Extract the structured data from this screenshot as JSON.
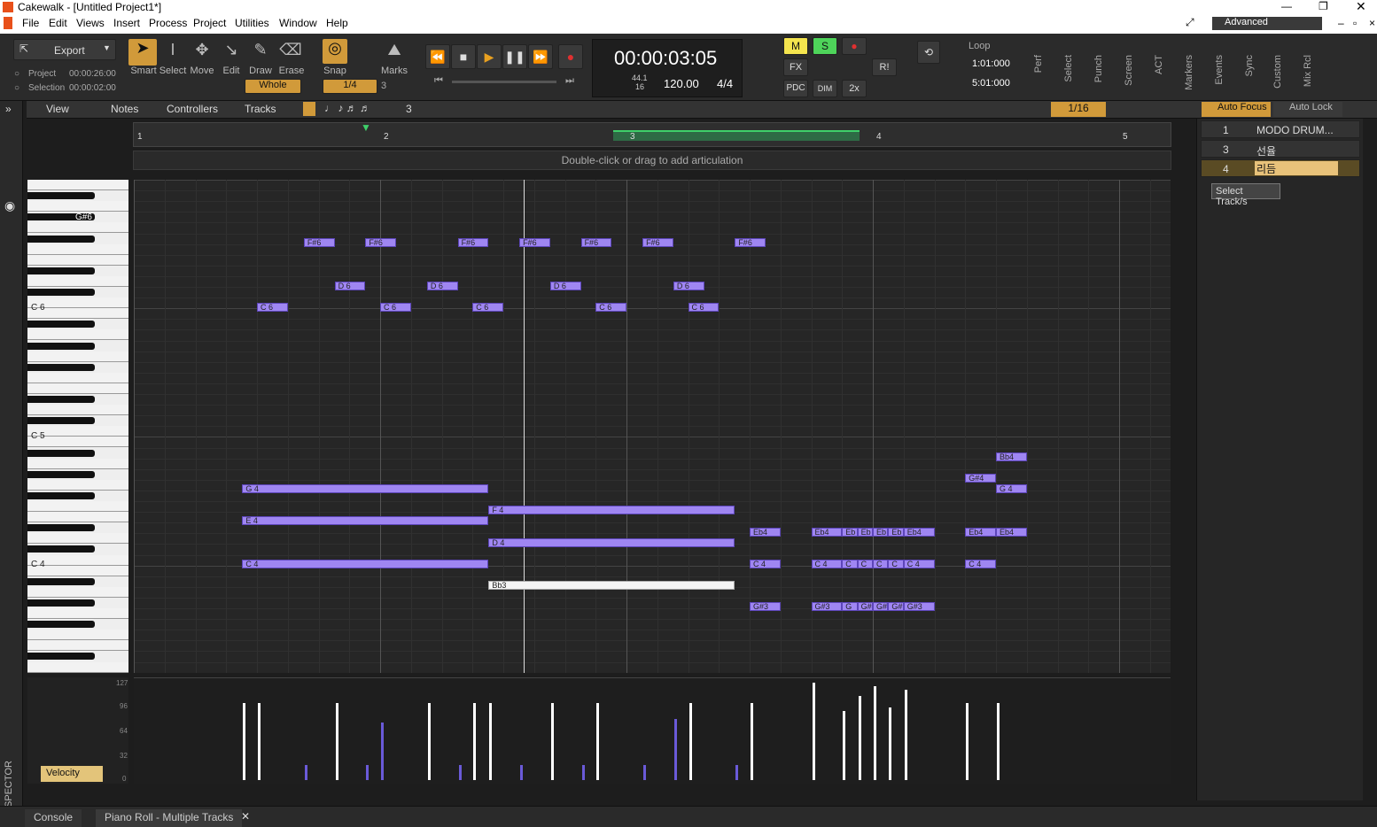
{
  "app": {
    "title": "Cakewalk - [Untitled Project1*]"
  },
  "menu": [
    "File",
    "Edit",
    "Views",
    "Insert",
    "Process",
    "Project",
    "Utilities",
    "Window",
    "Help"
  ],
  "workspace": {
    "label": "Advanced"
  },
  "export": {
    "label": "Export",
    "project_label": "Project",
    "project_time": "00:00:26:00",
    "selection_label": "Selection",
    "selection_time": "00:00:02:00"
  },
  "tools": [
    "Smart",
    "Select",
    "Move",
    "Edit",
    "Draw",
    "Erase"
  ],
  "snap": {
    "label": "Snap",
    "value": "Whole",
    "marks": "Marks",
    "fraction": "1/4",
    "tuplet": "3"
  },
  "transport": {
    "time": "00:00:03:05",
    "sample_rate": "44.1",
    "bits": "16",
    "tempo": "120.00",
    "meter": "4/4"
  },
  "mix": {
    "m": "M",
    "s": "S",
    "fx": "FX",
    "pdc": "PDC",
    "dim": "DIM",
    "x2": "2x",
    "r": "R!"
  },
  "loop": {
    "label": "Loop",
    "start": "1:01:000",
    "end": "5:01:000"
  },
  "modules": [
    "Perf",
    "Select",
    "Punch",
    "Screen",
    "ACT",
    "Markers",
    "Events",
    "Sync",
    "Custom",
    "Mix Rcl"
  ],
  "subbar": {
    "view": "View",
    "notes": "Notes",
    "controllers": "Controllers",
    "tracks": "Tracks",
    "tuplet": "3",
    "grid": "1/16",
    "auto_focus": "Auto Focus",
    "auto_lock": "Auto Lock"
  },
  "ruler": {
    "bars": [
      "1",
      "2",
      "3",
      "4",
      "5"
    ]
  },
  "articulation_hint": "Double-click or drag to add articulation",
  "keys": {
    "g6": "G#6",
    "c6": "C 6",
    "c5": "C 5",
    "c4": "C 4"
  },
  "notes": [
    {
      "label": "F#6",
      "row": "Fs6",
      "start": 2.38,
      "len": 0.25
    },
    {
      "label": "F#6",
      "row": "Fs6",
      "start": 2.88,
      "len": 0.25
    },
    {
      "label": "F#6",
      "row": "Fs6",
      "start": 3.63,
      "len": 0.25
    },
    {
      "label": "F#6",
      "row": "Fs6",
      "start": 4.13,
      "len": 0.25
    },
    {
      "label": "F#6",
      "row": "Fs6",
      "start": 4.63,
      "len": 0.25
    },
    {
      "label": "F#6",
      "row": "Fs6",
      "start": 5.13,
      "len": 0.25
    },
    {
      "label": "F#6",
      "row": "Fs6",
      "start": 5.88,
      "len": 0.25
    },
    {
      "label": "D 6",
      "row": "D6",
      "start": 2.63,
      "len": 0.25
    },
    {
      "label": "D 6",
      "row": "D6",
      "start": 3.38,
      "len": 0.25
    },
    {
      "label": "D 6",
      "row": "D6",
      "start": 4.38,
      "len": 0.25
    },
    {
      "label": "D 6",
      "row": "D6",
      "start": 5.38,
      "len": 0.25
    },
    {
      "label": "C 6",
      "row": "C6",
      "start": 2.0,
      "len": 0.25
    },
    {
      "label": "C 6",
      "row": "C6",
      "start": 3.0,
      "len": 0.25
    },
    {
      "label": "C 6",
      "row": "C6",
      "start": 3.75,
      "len": 0.25
    },
    {
      "label": "C 6",
      "row": "C6",
      "start": 4.75,
      "len": 0.25
    },
    {
      "label": "C 6",
      "row": "C6",
      "start": 5.5,
      "len": 0.25
    },
    {
      "label": "G 4",
      "row": "G4",
      "start": 1.88,
      "len": 2.0
    },
    {
      "label": "E 4",
      "row": "E4",
      "start": 1.88,
      "len": 2.0
    },
    {
      "label": "C 4",
      "row": "C4",
      "start": 1.88,
      "len": 2.0
    },
    {
      "label": "F 4",
      "row": "F4",
      "start": 3.88,
      "len": 2.0
    },
    {
      "label": "D 4",
      "row": "D4",
      "start": 3.88,
      "len": 2.0
    },
    {
      "label": "Bb3",
      "row": "Bb3",
      "start": 3.88,
      "len": 2.0,
      "selected": true
    },
    {
      "label": "Eb4",
      "row": "Eb4",
      "start": 6.0,
      "len": 0.25
    },
    {
      "label": "C 4",
      "row": "C4",
      "start": 6.0,
      "len": 0.25
    },
    {
      "label": "G#3",
      "row": "Gs3",
      "start": 6.0,
      "len": 0.25
    },
    {
      "label": "Eb4",
      "row": "Eb4",
      "start": 6.5,
      "len": 0.25
    },
    {
      "label": "C 4",
      "row": "C4",
      "start": 6.5,
      "len": 0.25
    },
    {
      "label": "G#3",
      "row": "Gs3",
      "start": 6.5,
      "len": 0.25
    },
    {
      "label": "Eb",
      "row": "Eb4",
      "start": 6.75,
      "len": 0.125
    },
    {
      "label": "C",
      "row": "C4",
      "start": 6.75,
      "len": 0.125
    },
    {
      "label": "G",
      "row": "Gs3",
      "start": 6.75,
      "len": 0.125
    },
    {
      "label": "Eb",
      "row": "Eb4",
      "start": 6.875,
      "len": 0.125
    },
    {
      "label": "C",
      "row": "C4",
      "start": 6.875,
      "len": 0.125
    },
    {
      "label": "G#",
      "row": "Gs3",
      "start": 6.875,
      "len": 0.125
    },
    {
      "label": "Eb",
      "row": "Eb4",
      "start": 7.0,
      "len": 0.125
    },
    {
      "label": "C",
      "row": "C4",
      "start": 7.0,
      "len": 0.125
    },
    {
      "label": "G#",
      "row": "Gs3",
      "start": 7.0,
      "len": 0.125
    },
    {
      "label": "Eb",
      "row": "Eb4",
      "start": 7.125,
      "len": 0.125
    },
    {
      "label": "C",
      "row": "C4",
      "start": 7.125,
      "len": 0.125
    },
    {
      "label": "G#",
      "row": "Gs3",
      "start": 7.125,
      "len": 0.125
    },
    {
      "label": "Eb4",
      "row": "Eb4",
      "start": 7.25,
      "len": 0.25
    },
    {
      "label": "C 4",
      "row": "C4",
      "start": 7.25,
      "len": 0.25
    },
    {
      "label": "G#3",
      "row": "Gs3",
      "start": 7.25,
      "len": 0.25
    },
    {
      "label": "Eb4",
      "row": "Eb4",
      "start": 7.75,
      "len": 0.25
    },
    {
      "label": "C 4",
      "row": "C4",
      "start": 7.75,
      "len": 0.25
    },
    {
      "label": "G#4",
      "row": "Gs4",
      "start": 7.75,
      "len": 0.25
    },
    {
      "label": "Eb4",
      "row": "Eb4",
      "start": 8.0,
      "len": 0.25
    },
    {
      "label": "G 4",
      "row": "G4",
      "start": 8.0,
      "len": 0.25
    },
    {
      "label": "Bb4",
      "row": "Bb4",
      "start": 8.0,
      "len": 0.25
    }
  ],
  "velocity": {
    "label": "Velocity",
    "scale": [
      "127",
      "96",
      "64",
      "32",
      "0"
    ],
    "values": [
      {
        "x": 1.88,
        "v": 100
      },
      {
        "x": 2.0,
        "v": 100
      },
      {
        "x": 2.38,
        "v": 20,
        "dim": true
      },
      {
        "x": 2.63,
        "v": 100
      },
      {
        "x": 2.88,
        "v": 20,
        "dim": true
      },
      {
        "x": 3.0,
        "v": 75,
        "dim": true
      },
      {
        "x": 3.38,
        "v": 100
      },
      {
        "x": 3.63,
        "v": 20,
        "dim": true
      },
      {
        "x": 3.75,
        "v": 100
      },
      {
        "x": 3.88,
        "v": 100
      },
      {
        "x": 4.13,
        "v": 20,
        "dim": true
      },
      {
        "x": 4.38,
        "v": 100
      },
      {
        "x": 4.63,
        "v": 20,
        "dim": true
      },
      {
        "x": 4.75,
        "v": 100
      },
      {
        "x": 5.13,
        "v": 20,
        "dim": true
      },
      {
        "x": 5.38,
        "v": 80,
        "dim": true
      },
      {
        "x": 5.5,
        "v": 100
      },
      {
        "x": 5.88,
        "v": 20,
        "dim": true
      },
      {
        "x": 6.0,
        "v": 100
      },
      {
        "x": 6.5,
        "v": 127
      },
      {
        "x": 6.75,
        "v": 90
      },
      {
        "x": 6.875,
        "v": 110
      },
      {
        "x": 7.0,
        "v": 122
      },
      {
        "x": 7.125,
        "v": 95
      },
      {
        "x": 7.25,
        "v": 118
      },
      {
        "x": 7.75,
        "v": 100
      },
      {
        "x": 8.0,
        "v": 100
      }
    ]
  },
  "tracks": [
    {
      "num": "1",
      "name": "MODO DRUM..."
    },
    {
      "num": "3",
      "name": "선율"
    },
    {
      "num": "4",
      "name": "리듬"
    }
  ],
  "tooltip": "Select Track/s",
  "bottom": {
    "console": "Console",
    "pianoroll": "Piano Roll - Multiple Tracks",
    "inspector": "INSPECTOR"
  }
}
